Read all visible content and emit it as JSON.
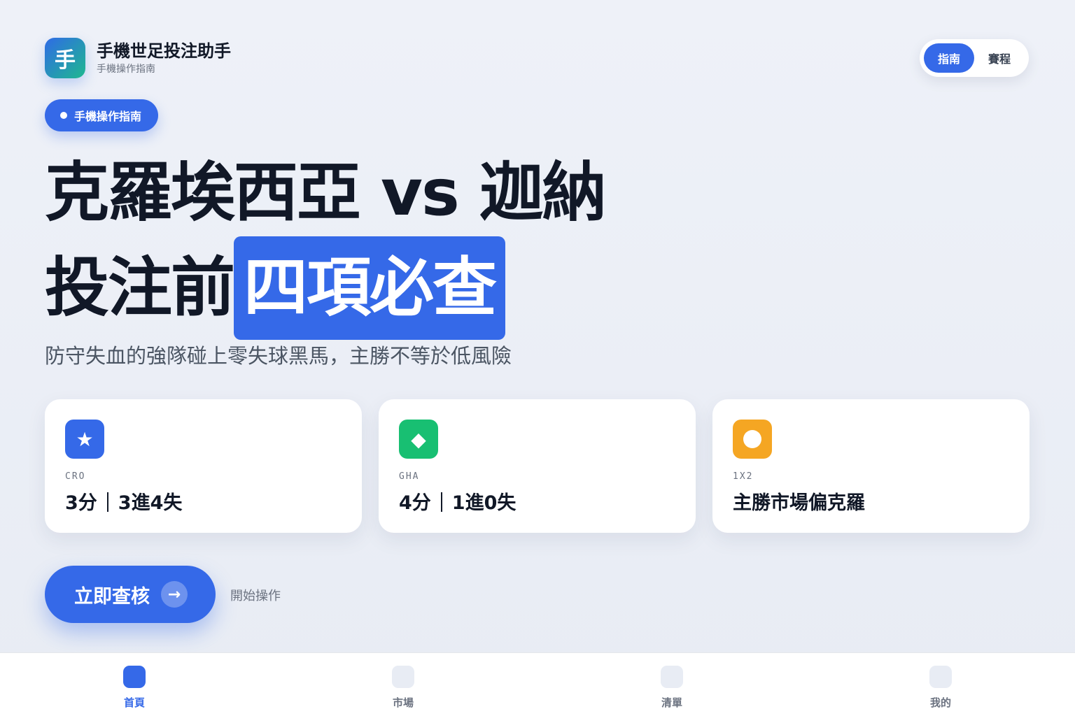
{
  "header": {
    "app_icon_char": "手",
    "title": "手機世足投注助手",
    "subtitle": "手機操作指南"
  },
  "segmented": {
    "items": [
      {
        "label": "指南",
        "active": true
      },
      {
        "label": "賽程",
        "active": false
      }
    ]
  },
  "badge": {
    "label": "手機操作指南"
  },
  "hero": {
    "line1": "克羅埃西亞 vs 迦納",
    "line2_plain": "投注前",
    "line2_highlight": "四項必查"
  },
  "subtitle": "防守失血的強隊碰上零失球黑馬，主勝不等於低風險",
  "cards": [
    {
      "icon": "star-icon",
      "glyph": "★",
      "color": "#3569e8",
      "code": "CRO",
      "value_a": "3分",
      "value_b": "3進4失"
    },
    {
      "icon": "diamond-icon",
      "glyph": "◆",
      "color": "#18bf72",
      "code": "GHA",
      "value_a": "4分",
      "value_b": "1進0失"
    },
    {
      "icon": "circle-icon",
      "glyph": "●",
      "color": "#f5a623",
      "code": "1X2",
      "value_a": "主勝市場偏克羅",
      "value_b": ""
    }
  ],
  "cta": {
    "label": "立即查核",
    "arrow": "→",
    "hint": "開始操作"
  },
  "tabbar": {
    "items": [
      {
        "label": "首頁",
        "active": true
      },
      {
        "label": "市場",
        "active": false
      },
      {
        "label": "清單",
        "active": false
      },
      {
        "label": "我的",
        "active": false
      }
    ]
  },
  "colors": {
    "accent": "#3569e8",
    "green": "#18bf72",
    "orange": "#f5a623"
  }
}
